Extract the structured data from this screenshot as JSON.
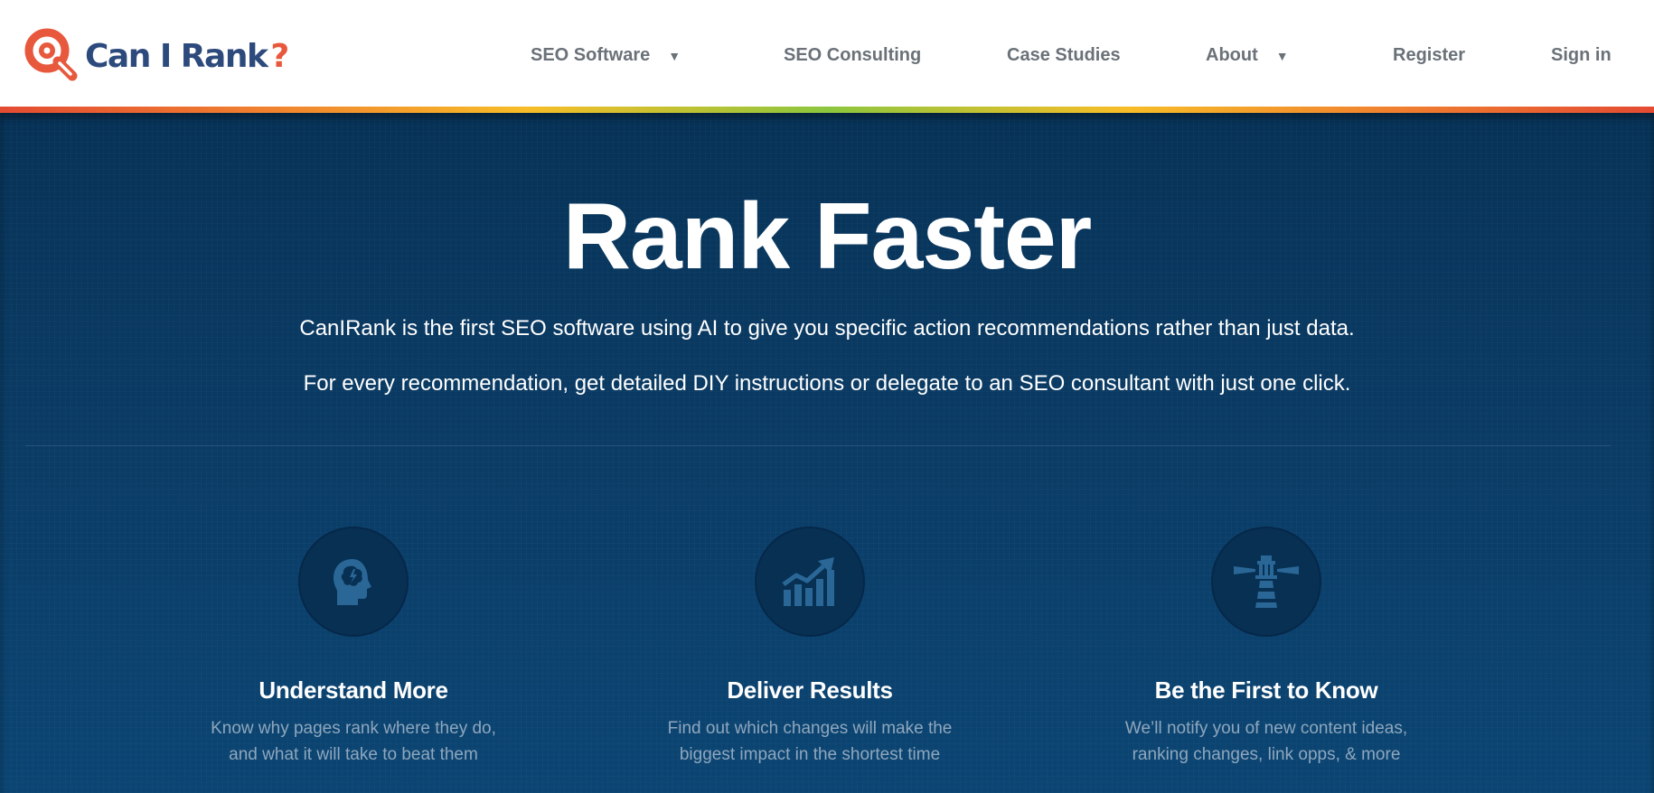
{
  "brand": {
    "name": "Can I Rank",
    "suffix": "?",
    "icon": "magnifier-q-logo-icon",
    "colors": {
      "navy": "#2d4a7d",
      "orange": "#e8583d"
    }
  },
  "nav": {
    "items": [
      {
        "label": "SEO Software",
        "has_dropdown": true
      },
      {
        "label": "SEO Consulting",
        "has_dropdown": false
      },
      {
        "label": "Case Studies",
        "has_dropdown": false
      },
      {
        "label": "About",
        "has_dropdown": true
      },
      {
        "label": "Register",
        "has_dropdown": false
      },
      {
        "label": "Sign in",
        "has_dropdown": false
      }
    ],
    "caret": "▼"
  },
  "hero": {
    "title": "Rank Faster",
    "line1": "CanIRank is the first SEO software using AI to give you specific action recommendations rather than just data.",
    "line2": "For every recommendation, get detailed DIY instructions or delegate to an SEO consultant with just one click.",
    "background": "#0a3b64"
  },
  "features": [
    {
      "icon": "brain-head-icon",
      "title": "Understand More",
      "desc_line1": "Know why pages rank where they do,",
      "desc_line2": "and what it will take to beat them"
    },
    {
      "icon": "growth-chart-icon",
      "title": "Deliver Results",
      "desc_line1": "Find out which changes will make the",
      "desc_line2": "biggest impact in the shortest time"
    },
    {
      "icon": "lighthouse-icon",
      "title": "Be the First to Know",
      "desc_line1": "We’ll notify you of new content ideas,",
      "desc_line2": "ranking changes, link opps, & more"
    }
  ],
  "colors": {
    "accent_bar": [
      "#e34b33",
      "#f7bd28",
      "#8cc63e"
    ],
    "icon_fill": "#2a6797",
    "nav_text": "#6a7178"
  }
}
